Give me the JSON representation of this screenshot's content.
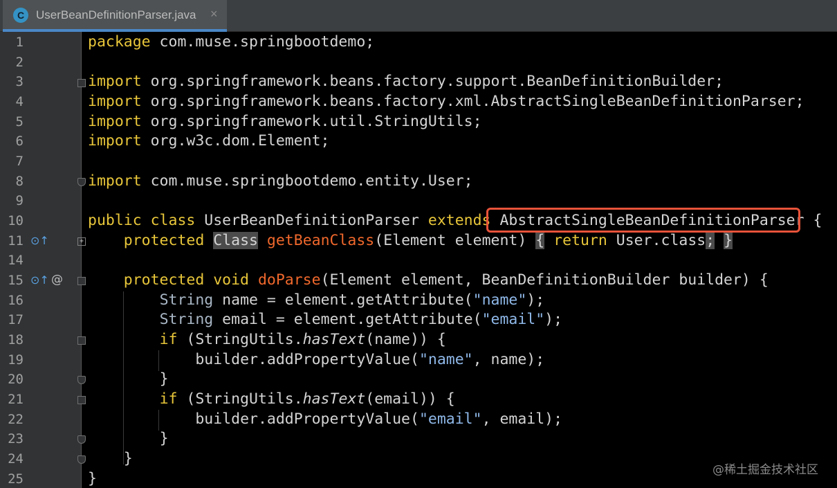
{
  "tab": {
    "icon_letter": "C",
    "title": "UserBeanDefinitionParser.java",
    "close_glyph": "×"
  },
  "line_numbers": [
    "1",
    "2",
    "3",
    "4",
    "5",
    "6",
    "7",
    "8",
    "9",
    "10",
    "11",
    "14",
    "15",
    "16",
    "17",
    "18",
    "19",
    "20",
    "21",
    "22",
    "23",
    "24",
    "25"
  ],
  "code": {
    "l1": {
      "kw": "package",
      "rest": " com.muse.springbootdemo;"
    },
    "l3": {
      "kw": "import",
      "rest": " org.springframework.beans.factory.support.BeanDefinitionBuilder;"
    },
    "l4": {
      "kw": "import",
      "rest": " org.springframework.beans.factory.xml.AbstractSingleBeanDefinitionParser;"
    },
    "l5": {
      "kw": "import",
      "rest": " org.springframework.util.StringUtils;"
    },
    "l6": {
      "kw": "import",
      "rest": " org.w3c.dom.Element;"
    },
    "l8": {
      "kw": "import",
      "rest": " com.muse.springbootdemo.entity.User;"
    },
    "l10": {
      "kw1": "public class",
      "name": " UserBeanDefinitionParser ",
      "kw2": "extends",
      "sp": " ",
      "parent": "AbstractSingleBeanDefinitionParser",
      "brace": " {"
    },
    "l11": {
      "indent": "    ",
      "kw": "protected",
      "sp": " ",
      "type": "Class",
      "sp2": " ",
      "fn": "getBeanClass",
      "params": "(Element element)",
      "sp3": " ",
      "ob": "{",
      "ret": " return ",
      "rt": "User.class",
      "semi": ";",
      "sp4": " ",
      "cb": "}"
    },
    "l15": {
      "indent": "    ",
      "kw": "protected void",
      "sp": " ",
      "fn": "doParse",
      "params": "(Element element, BeanDefinitionBuilder builder) {"
    },
    "l16": {
      "indent": "        ",
      "type": "String",
      "rest": " name = element.getAttribute(",
      "str": "\"name\"",
      "end": ");"
    },
    "l17": {
      "indent": "        ",
      "type": "String",
      "rest": " email = element.getAttribute(",
      "str": "\"email\"",
      "end": ");"
    },
    "l18": {
      "indent": "        ",
      "kw": "if",
      "pre": " (StringUtils.",
      "it": "hasText",
      "post": "(name)) {"
    },
    "l19": {
      "indent": "            ",
      "pre": "builder.addPropertyValue(",
      "str": "\"name\"",
      "post": ", name);"
    },
    "l20": {
      "indent": "        ",
      "text": "}"
    },
    "l21": {
      "indent": "        ",
      "kw": "if",
      "pre": " (StringUtils.",
      "it": "hasText",
      "post": "(email)) {"
    },
    "l22": {
      "indent": "            ",
      "pre": "builder.addPropertyValue(",
      "str": "\"email\"",
      "post": ", email);"
    },
    "l23": {
      "indent": "        ",
      "text": "}"
    },
    "l24": {
      "indent": "    ",
      "text": "}"
    },
    "l25": {
      "text": "}"
    }
  },
  "gutter_icons": {
    "override_glyph": "⊙↑",
    "at_glyph": "@"
  },
  "watermark": "@稀土掘金技术社区",
  "colors": {
    "keyword": "#e8c63a",
    "method": "#f0682c",
    "string": "#8fb8e8",
    "highlight_box": "#e8533a",
    "background": "#000000"
  }
}
